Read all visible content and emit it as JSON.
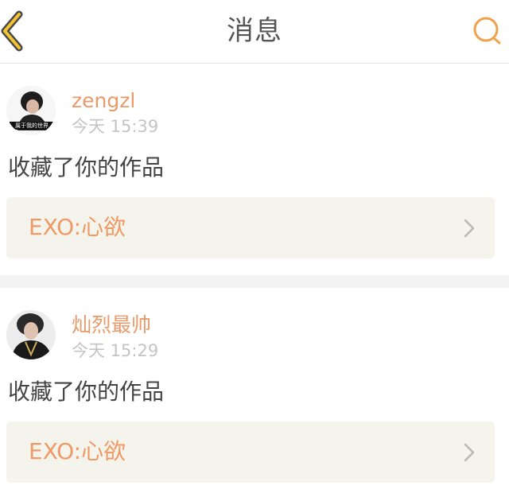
{
  "header": {
    "title": "消息",
    "back_icon": "chevron-left-icon",
    "search_icon": "search-icon",
    "accent_color": "#f0a24a"
  },
  "messages": [
    {
      "username": "zengzl",
      "time": "今天 15:39",
      "action": "收藏了你的作品",
      "work_title": "EXO:心欲",
      "avatar_caption": "属于我的世界"
    },
    {
      "username": "灿烈最帅",
      "time": "今天 15:29",
      "action": "收藏了你的作品",
      "work_title": "EXO:心欲"
    }
  ],
  "colors": {
    "username": "#e89a6a",
    "work_title": "#ef9a66",
    "work_card_bg": "#f4f4ec",
    "separator": "#f3f3f3"
  }
}
